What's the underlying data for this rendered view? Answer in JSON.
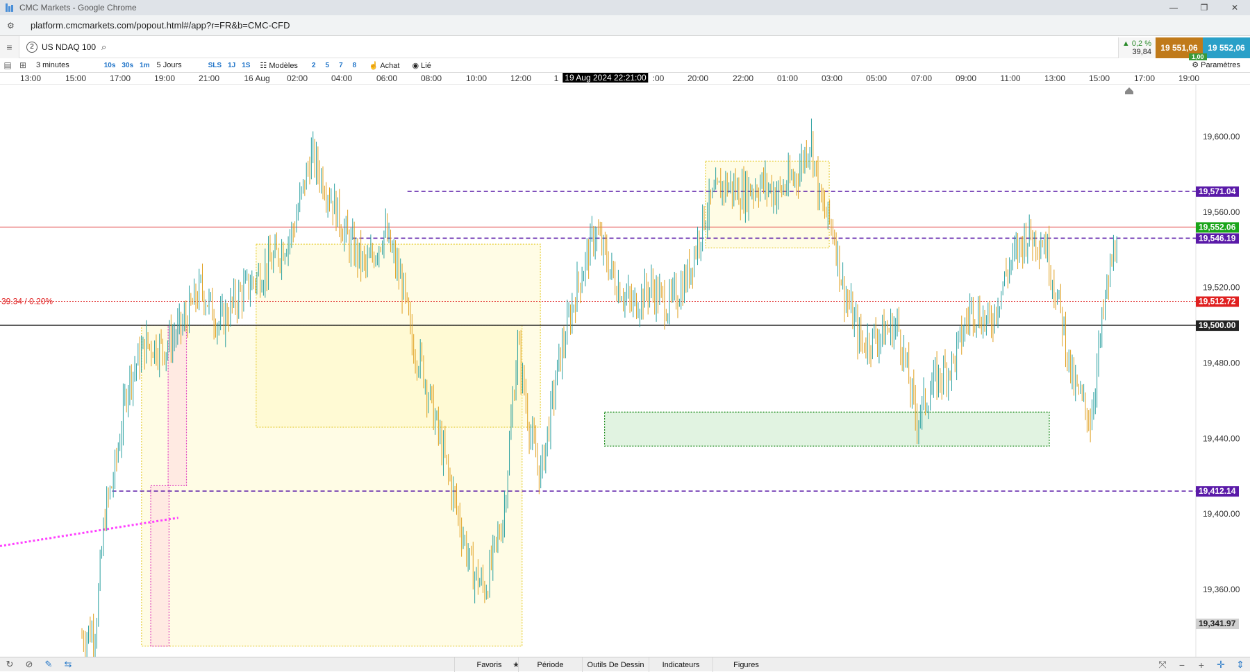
{
  "browser": {
    "title": "CMC Markets - Google Chrome",
    "url": "platform.cmcmarkets.com/popout.html#/app?r=FR&b=CMC-CFD"
  },
  "instrument": {
    "index": "2",
    "name": "US NDAQ 100"
  },
  "quote": {
    "change_pct": "0,2 %",
    "change_abs": "39,84",
    "sell": "19 551,06",
    "buy": "19 552,06",
    "spread": "1,00"
  },
  "toolbar": {
    "interval": "3 minutes",
    "btn_10s": "10s",
    "btn_30s": "30s",
    "btn_1m": "1m",
    "range": "5 Jours",
    "btn_sls": "SLS",
    "btn_1j": "1J",
    "btn_1s": "1S",
    "models": "Modèles",
    "n2": "2",
    "n5": "5",
    "n7": "7",
    "n8": "8",
    "buy": "Achat",
    "linked": "Lié",
    "settings": "Paramètres"
  },
  "time_axis": {
    "labels": [
      "13:00",
      "15:00",
      "17:00",
      "19:00",
      "21:00",
      "16 Aug",
      "02:00",
      "04:00",
      "06:00",
      "08:00",
      "10:00",
      "12:00",
      "1",
      "20:00",
      "22:00",
      "01:00",
      "03:00",
      "05:00",
      "07:00",
      "09:00",
      "11:00",
      "13:00",
      "15:00",
      "17:00",
      "19:00"
    ],
    "cursor": "19 Aug 2024 22:21:00",
    "cursor_tail": ":00"
  },
  "price_axis": {
    "ticks": [
      "19,600.00",
      "19,560.00",
      "19,520.00",
      "19,480.00",
      "19,440.00",
      "19,400.00",
      "19,360.00"
    ],
    "tags": {
      "level_high": "19,571.04",
      "current": "19,552.06",
      "level_mid": "19,546.19",
      "reference": "19,512.72",
      "round": "19,500.00",
      "level_low": "19,412.14",
      "chart_low": "19,341.97"
    },
    "ref_label": "39.34 / 0.20%"
  },
  "colors": {
    "up_candle": "#2aa0a0",
    "down_candle": "#e0a020",
    "dashed_level": "#5a1aa8",
    "current_price": "#1aa51a",
    "reference": "#e02020"
  },
  "chart_data": {
    "type": "candlestick",
    "ylim": [
      19330,
      19630
    ],
    "path": [
      [
        0,
        19335
      ],
      [
        1.5,
        19340
      ],
      [
        2.5,
        19400
      ],
      [
        3.5,
        19420
      ],
      [
        5,
        19470
      ],
      [
        7,
        19490
      ],
      [
        9,
        19488
      ],
      [
        11,
        19500
      ],
      [
        13,
        19520
      ],
      [
        15,
        19500
      ],
      [
        17,
        19515
      ],
      [
        19,
        19525
      ],
      [
        21,
        19535
      ],
      [
        23,
        19550
      ],
      [
        25,
        19590
      ],
      [
        27,
        19570
      ],
      [
        29,
        19545
      ],
      [
        31,
        19530
      ],
      [
        33,
        19550
      ],
      [
        35,
        19520
      ],
      [
        36,
        19490
      ],
      [
        37,
        19480
      ],
      [
        39,
        19440
      ],
      [
        41,
        19400
      ],
      [
        42.5,
        19370
      ],
      [
        44,
        19360
      ],
      [
        46,
        19400
      ],
      [
        47.5,
        19490
      ],
      [
        49,
        19440
      ],
      [
        50,
        19420
      ],
      [
        52,
        19480
      ],
      [
        54,
        19520
      ],
      [
        56,
        19550
      ],
      [
        58,
        19525
      ],
      [
        60,
        19510
      ],
      [
        62,
        19520
      ],
      [
        64,
        19510
      ],
      [
        66,
        19525
      ],
      [
        68,
        19560
      ],
      [
        70,
        19575
      ],
      [
        72,
        19570
      ],
      [
        74,
        19575
      ],
      [
        76,
        19570
      ],
      [
        78,
        19580
      ],
      [
        79.5,
        19600
      ],
      [
        80.5,
        19565
      ],
      [
        82,
        19550
      ],
      [
        83,
        19520
      ],
      [
        85,
        19490
      ],
      [
        87,
        19495
      ],
      [
        89,
        19500
      ],
      [
        91,
        19450
      ],
      [
        93,
        19470
      ],
      [
        95,
        19480
      ],
      [
        97,
        19510
      ],
      [
        99,
        19500
      ],
      [
        101,
        19530
      ],
      [
        103,
        19548
      ],
      [
        105,
        19545
      ],
      [
        107,
        19500
      ],
      [
        108,
        19470
      ],
      [
        110,
        19450
      ],
      [
        111.5,
        19510
      ],
      [
        113,
        19552
      ]
    ],
    "levels": [
      {
        "label": "19,571.04",
        "value": 19571.04,
        "start": 35.5
      },
      {
        "label": "19,546.19",
        "value": 19546.19,
        "start": 29.5
      },
      {
        "label": "19,412.14",
        "value": 19412.14,
        "start": 3.3
      }
    ],
    "reference": 19512.72,
    "round_level": 19500,
    "current": 19552.06,
    "zones": [
      {
        "kind": "yellow",
        "x0": 6.5,
        "x1": 48,
        "y0": 19330,
        "y1": 19500
      },
      {
        "kind": "yellow",
        "x0": 19,
        "x1": 50,
        "y0": 19446,
        "y1": 19543
      },
      {
        "kind": "yellow",
        "x0": 68,
        "x1": 81.5,
        "y0": 19541,
        "y1": 19587
      },
      {
        "kind": "green",
        "x0": 57,
        "x1": 105.5,
        "y0": 19436,
        "y1": 19454
      },
      {
        "kind": "pink",
        "x0": 9.4,
        "x1": 11.4,
        "y0": 19415,
        "y1": 19500
      },
      {
        "kind": "pink",
        "x0": 7.5,
        "x1": 9.5,
        "y0": 19330,
        "y1": 19415
      }
    ]
  },
  "bottom": {
    "favoris": "Favoris",
    "periode": "Période",
    "outils": "Outils De Dessin",
    "indicateurs": "Indicateurs",
    "figures": "Figures"
  }
}
